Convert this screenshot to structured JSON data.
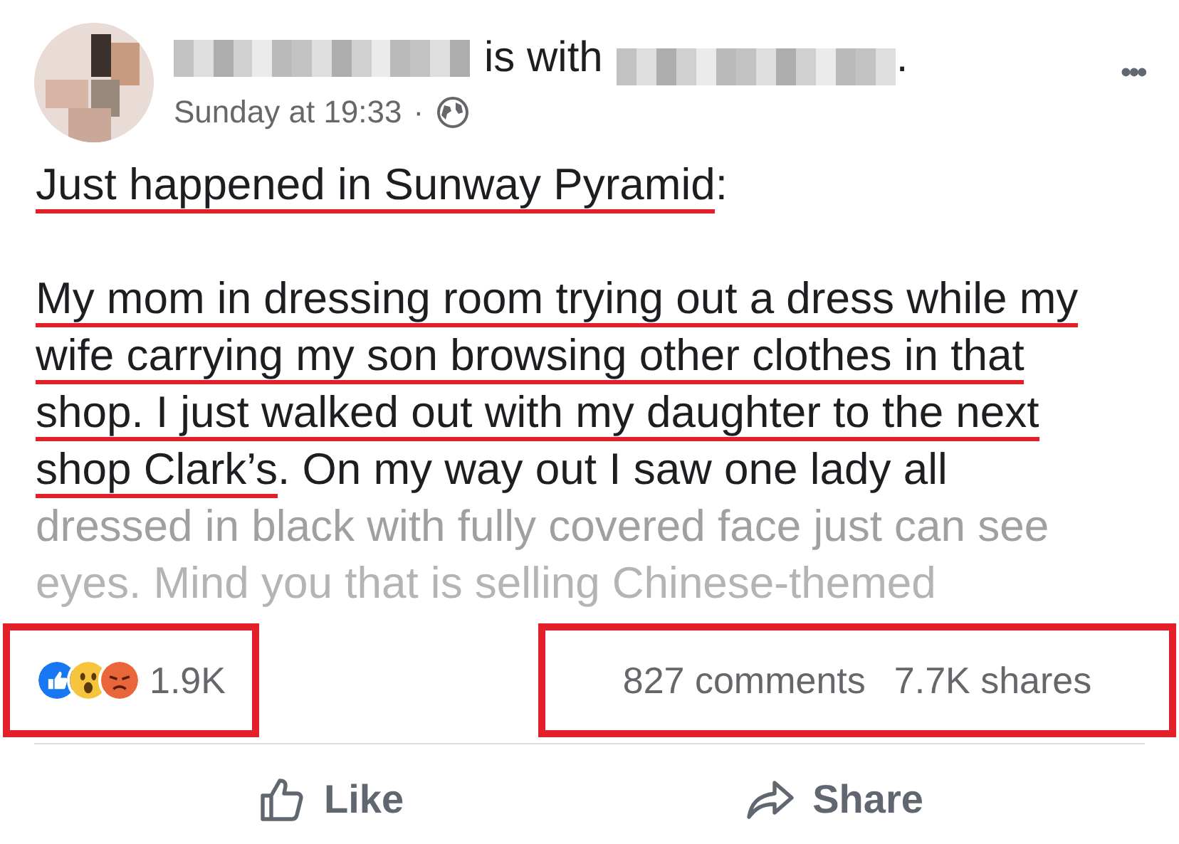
{
  "post": {
    "author_redacted": true,
    "connector": "is with",
    "tagged_redacted": true,
    "end_mark": ".",
    "time": "Sunday at 19:33",
    "separator": "·",
    "more": "•••"
  },
  "body_lines": [
    {
      "kind": "normal",
      "segments": [
        {
          "text": "Just happened in Sunway Pyramid",
          "underlined": true
        },
        {
          "text": ":",
          "underlined": false
        }
      ]
    },
    {
      "kind": "blank"
    },
    {
      "kind": "normal",
      "segments": [
        {
          "text": "My mom in dressing room trying out a dress while my",
          "underlined": true
        }
      ]
    },
    {
      "kind": "normal",
      "segments": [
        {
          "text": "wife carrying my son browsing other clothes in that",
          "underlined": true
        }
      ]
    },
    {
      "kind": "normal",
      "segments": [
        {
          "text": "shop. I just walked out with my daughter to the next",
          "underlined": true
        }
      ]
    },
    {
      "kind": "normal",
      "segments": [
        {
          "text": "shop Clark’s",
          "underlined": true
        },
        {
          "text": ". On my way out I saw one lady all",
          "underlined": false
        }
      ]
    },
    {
      "kind": "fading",
      "segments": [
        {
          "text": "dressed in black with fully covered face just can see",
          "underlined": false
        }
      ]
    },
    {
      "kind": "faded",
      "segments": [
        {
          "text": "eyes. Mind you that is selling Chinese-themed",
          "underlined": false
        }
      ]
    }
  ],
  "stats": {
    "reactions": [
      {
        "kind": "like"
      },
      {
        "kind": "wow"
      },
      {
        "kind": "angry"
      }
    ],
    "reaction_count": "1.9K",
    "comments": "827 comments",
    "shares": "7.7K shares",
    "highlighted": true
  },
  "actions": [
    {
      "kind": "like",
      "label": "Like"
    },
    {
      "kind": "share",
      "label": "Share"
    }
  ]
}
